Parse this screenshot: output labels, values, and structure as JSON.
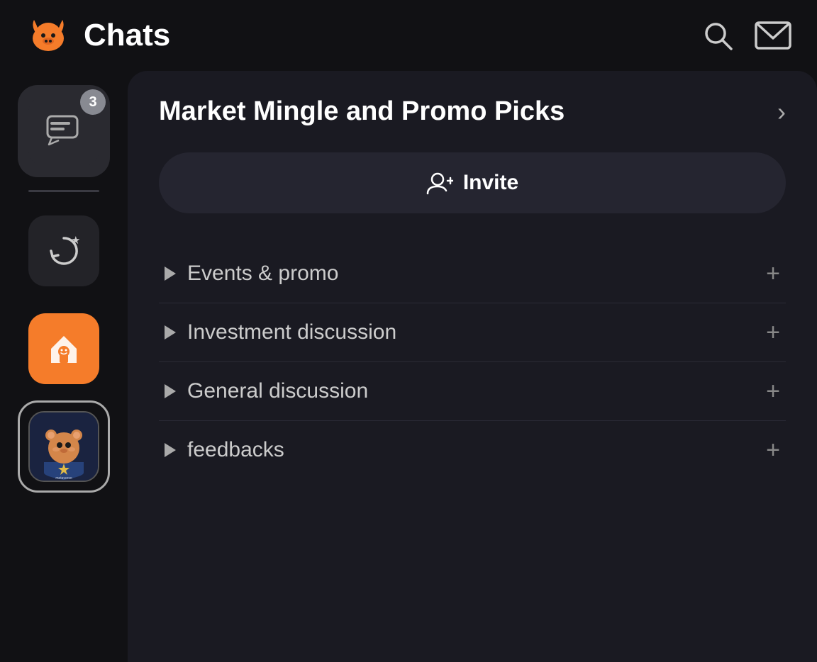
{
  "header": {
    "title": "Chats",
    "search_label": "search",
    "mail_label": "mail"
  },
  "sidebar": {
    "items": [
      {
        "id": "chats",
        "label": "Chats",
        "badge": "3",
        "icon": "chat-icon"
      },
      {
        "id": "refresh",
        "label": "Refresh/Star",
        "icon": "refresh-star-icon"
      },
      {
        "id": "home",
        "label": "Home",
        "icon": "home-icon"
      },
      {
        "id": "metaverso",
        "label": "Metaverso",
        "icon": "metaverso-icon"
      }
    ]
  },
  "content": {
    "channel_title": "Market Mingle and Promo Picks",
    "invite_button_label": "Invite",
    "categories": [
      {
        "id": "events-promo",
        "label": "Events & promo"
      },
      {
        "id": "investment-discussion",
        "label": "Investment discussion"
      },
      {
        "id": "general-discussion",
        "label": "General discussion"
      },
      {
        "id": "feedbacks",
        "label": "feedbacks"
      }
    ]
  },
  "colors": {
    "accent_orange": "#f57c2a",
    "bg_dark": "#111114",
    "bg_content": "#1a1a22",
    "bg_sidebar_active": "#2a2a30"
  }
}
